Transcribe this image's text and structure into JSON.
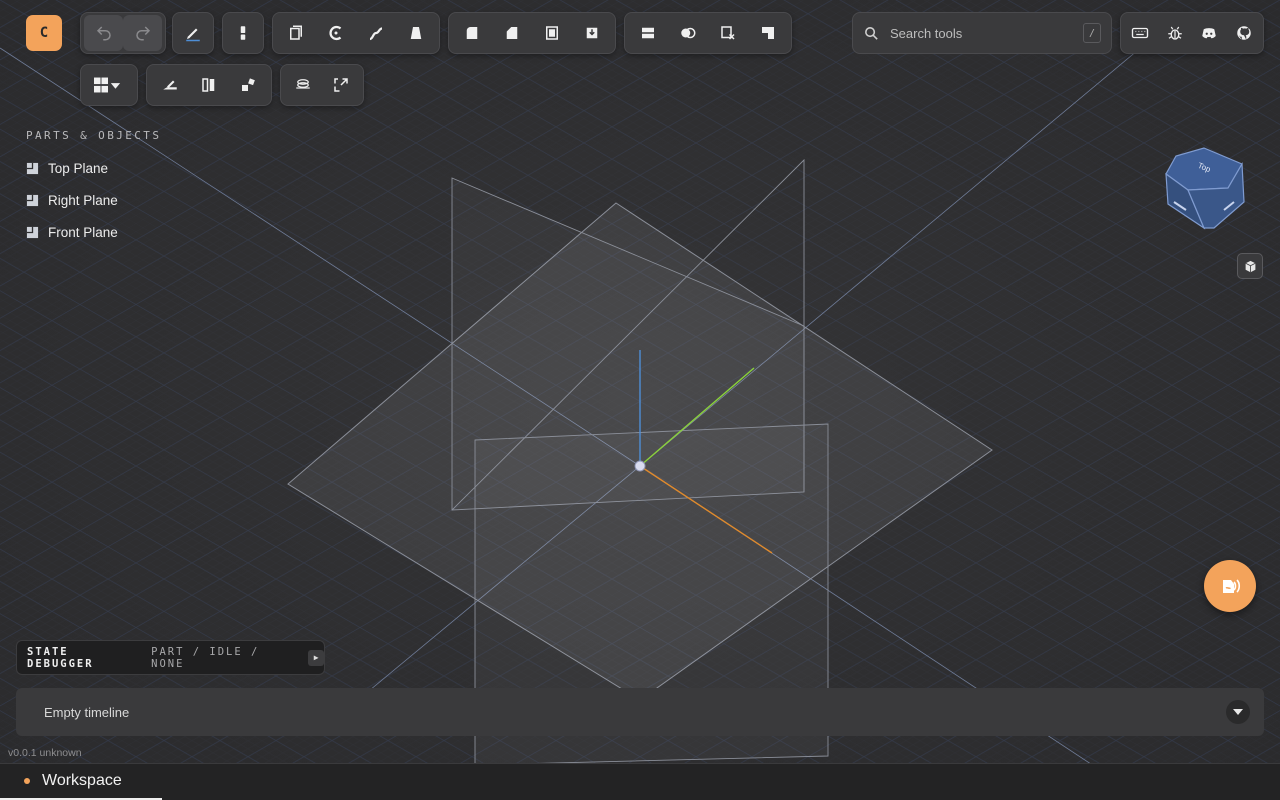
{
  "app": {
    "logo_letter": "C",
    "accent_color": "#f3a35b"
  },
  "toolbar": {
    "groups": [
      {
        "id": "history",
        "buttons": [
          {
            "icon": "undo-icon",
            "disabled": true
          },
          {
            "icon": "redo-icon",
            "disabled": true
          }
        ]
      },
      {
        "id": "sketch",
        "buttons": [
          {
            "icon": "pencil-sketch-icon"
          }
        ]
      },
      {
        "id": "gizmo",
        "buttons": [
          {
            "icon": "transform-gizmo-icon"
          }
        ]
      },
      {
        "id": "create",
        "buttons": [
          {
            "icon": "extrude-icon"
          },
          {
            "icon": "revolve-icon"
          },
          {
            "icon": "sweep-icon"
          },
          {
            "icon": "loft-icon"
          }
        ]
      },
      {
        "id": "modify",
        "buttons": [
          {
            "icon": "fillet-icon"
          },
          {
            "icon": "chamfer-icon"
          },
          {
            "icon": "shell-icon"
          },
          {
            "icon": "hole-icon"
          }
        ]
      },
      {
        "id": "boolean",
        "buttons": [
          {
            "icon": "offset-plane-icon"
          },
          {
            "icon": "boolean-icon"
          },
          {
            "icon": "delete-face-icon"
          },
          {
            "icon": "split-icon"
          }
        ]
      },
      {
        "id": "row2-view",
        "buttons": [
          {
            "icon": "layout-menu-icon"
          }
        ]
      },
      {
        "id": "row2-pattern",
        "buttons": [
          {
            "icon": "sketch-on-face-icon"
          },
          {
            "icon": "pattern-icon"
          },
          {
            "icon": "mirror-icon"
          }
        ]
      },
      {
        "id": "row2-misc",
        "buttons": [
          {
            "icon": "helix-icon"
          },
          {
            "icon": "expand-icon"
          }
        ]
      }
    ],
    "right": [
      {
        "icon": "keyboard-icon"
      },
      {
        "icon": "bug-icon"
      },
      {
        "icon": "discord-icon"
      },
      {
        "icon": "github-icon"
      }
    ]
  },
  "search": {
    "placeholder": "Search tools",
    "shortcut": "/"
  },
  "parts": {
    "heading": "PARTS & OBJECTS",
    "items": [
      {
        "label": "Top Plane"
      },
      {
        "label": "Right Plane"
      },
      {
        "label": "Front Plane"
      }
    ]
  },
  "nav_cube": {
    "face_label": "Top"
  },
  "state_debugger": {
    "title": "STATE DEBUGGER",
    "state": "PART / IDLE / NONE"
  },
  "timeline": {
    "empty_text": "Empty timeline"
  },
  "version": "v0.0.1 unknown",
  "tabs": [
    {
      "label": "Workspace",
      "active": true
    }
  ],
  "colors": {
    "background": "#2e2e30",
    "panel": "#3a3a3c",
    "axis_x": "#e08a2c",
    "axis_y": "#8ad23a",
    "axis_z": "#4e8ed6",
    "grid": "#3d4a66"
  }
}
